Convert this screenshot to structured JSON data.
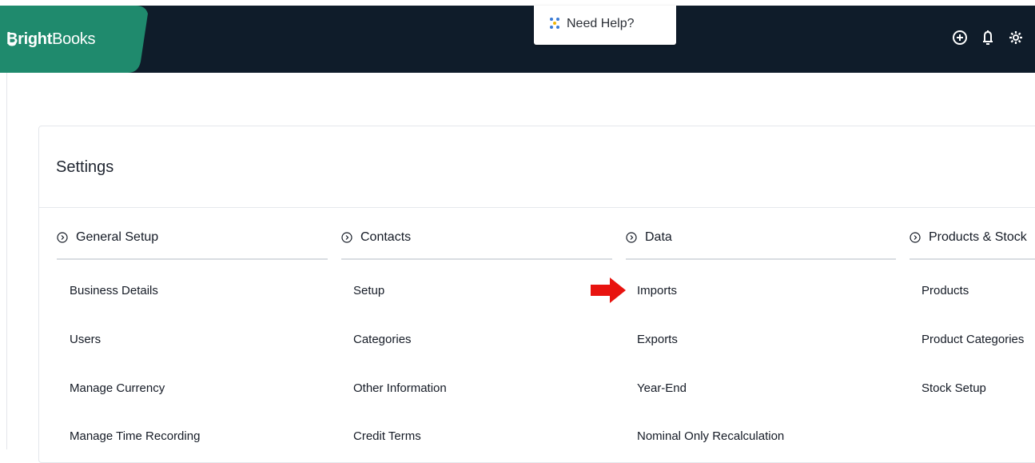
{
  "app": {
    "brand_bold": "Bright",
    "brand_rest": "Books"
  },
  "help": {
    "label": "Need Help?"
  },
  "header_icons": [
    "add-circle-icon",
    "bell-icon",
    "gear-icon"
  ],
  "colors": {
    "header_bg": "#0f1c2a",
    "brand_green": "#1f8a6d",
    "arrow_red": "#e8130f"
  },
  "settings": {
    "title": "Settings",
    "sections": [
      {
        "title": "General Setup",
        "items": [
          "Business Details",
          "Users",
          "Manage Currency",
          "Manage Time Recording"
        ]
      },
      {
        "title": "Contacts",
        "items": [
          "Setup",
          "Categories",
          "Other Information",
          "Credit Terms"
        ]
      },
      {
        "title": "Data",
        "items": [
          "Imports",
          "Exports",
          "Year-End",
          "Nominal Only Recalculation"
        ]
      },
      {
        "title": "Products & Stock",
        "items": [
          "Products",
          "Product Categories",
          "Stock Setup"
        ]
      }
    ]
  }
}
